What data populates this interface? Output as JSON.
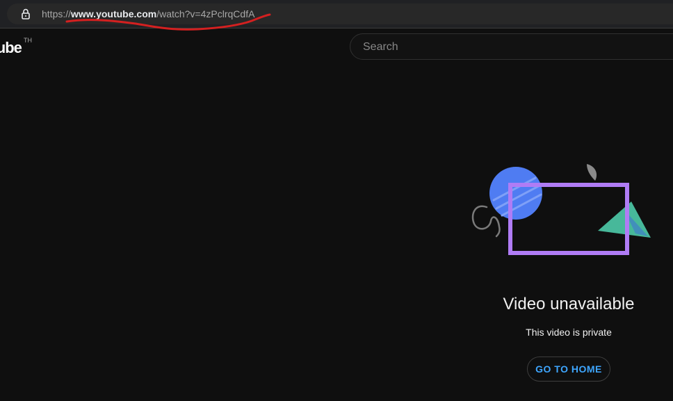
{
  "browser": {
    "url_scheme": "https://",
    "url_host": "www.youtube.com",
    "url_path": "/watch?v=4zPclrqCdfA"
  },
  "header": {
    "logo_text": "Tube",
    "country_code": "TH",
    "search_placeholder": "Search"
  },
  "error": {
    "title": "Video unavailable",
    "subtitle": "This video is private",
    "home_button_label": "GO TO HOME"
  },
  "colors": {
    "background": "#0f0f0f",
    "annotation_red": "#d42020",
    "accent_blue": "#3ea6ff",
    "illustration_circle": "#4f7cf2",
    "illustration_frame": "#b07cf5",
    "illustration_triangle": "#47b89a"
  }
}
